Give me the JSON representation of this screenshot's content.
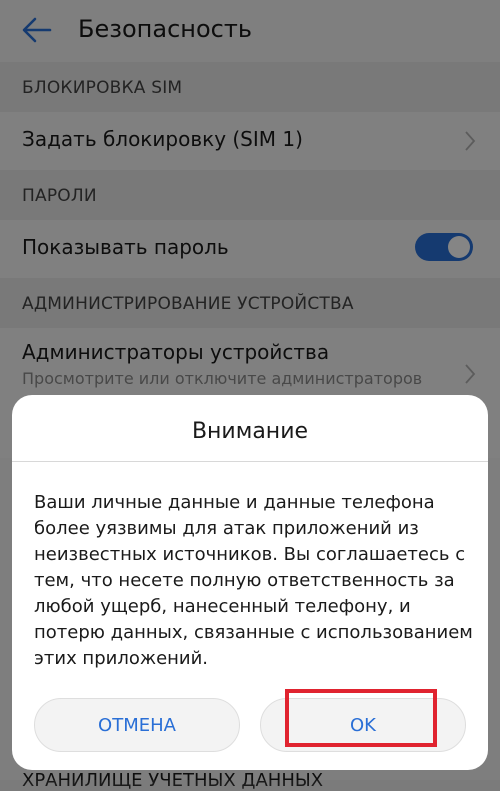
{
  "appbar": {
    "title": "Безопасность",
    "back_icon": "back-arrow-icon"
  },
  "sections": {
    "sim": {
      "header": "БЛОКИРОВКА SIM",
      "item_title": "Задать блокировку (SIM 1)"
    },
    "passwords": {
      "header": "ПАРОЛИ",
      "item_title": "Показывать пароль",
      "toggle_on": true
    },
    "admin": {
      "header": "АДМИНИСТРИРОВАНИЕ УСТРОЙСТВА",
      "item_title": "Администраторы устройства",
      "item_subtitle": "Просмотрите или отключите администраторов"
    }
  },
  "below_dialog_text": "ХРАНИЛИЩЕ УЧЕТНЫХ ДАННЫХ",
  "dialog": {
    "title": "Внимание",
    "message": "Ваши личные данные и данные телефона более уязвимы для атак приложений из неизвестных источников. Вы соглашаетесь с тем, что несете полную ответственность за любой ущерб, нанесенный телефону, и потерю данных, связанные с использованием этих приложений.",
    "cancel_label": "ОТМЕНА",
    "ok_label": "OK"
  },
  "colors": {
    "accent": "#2a6fd6",
    "highlight": "#e0232f"
  }
}
